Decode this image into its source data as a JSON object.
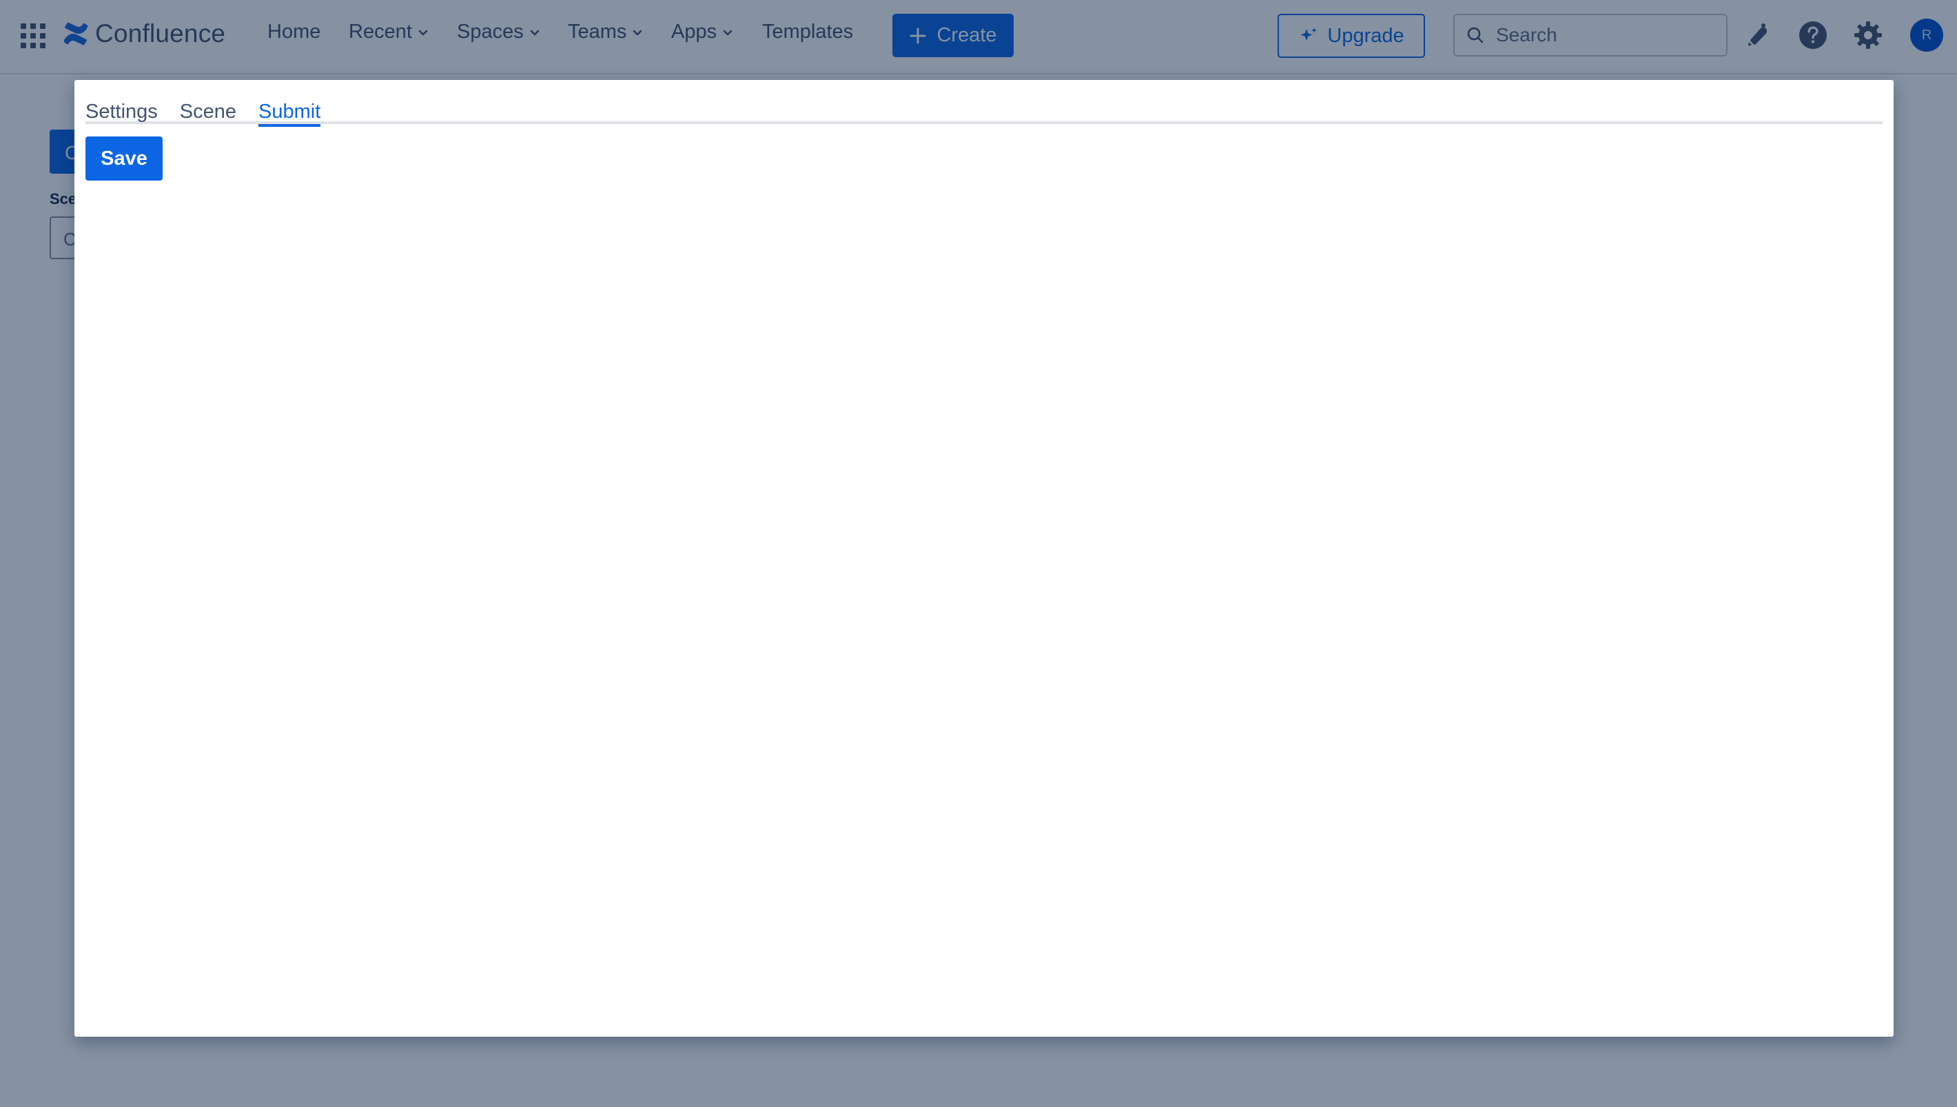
{
  "app": {
    "product_name": "Confluence",
    "brand_color": "#0c66e4"
  },
  "topnav": {
    "items": [
      {
        "label": "Home",
        "has_dropdown": false
      },
      {
        "label": "Recent",
        "has_dropdown": true
      },
      {
        "label": "Spaces",
        "has_dropdown": true
      },
      {
        "label": "Teams",
        "has_dropdown": true
      },
      {
        "label": "Apps",
        "has_dropdown": true
      },
      {
        "label": "Templates",
        "has_dropdown": false
      }
    ],
    "create_label": "Create",
    "upgrade_label": "Upgrade",
    "search_placeholder": "Search",
    "icons": [
      "app-switcher-icon",
      "confluence-logo-icon",
      "plus-icon",
      "sparkle-icon",
      "search-icon",
      "notification-icon",
      "help-icon",
      "settings-icon"
    ],
    "avatar_initial": "R"
  },
  "background_page": {
    "button_label": "C",
    "field_label": "Sce",
    "field_value": "C"
  },
  "modal": {
    "tabs": [
      {
        "label": "Settings",
        "active": false
      },
      {
        "label": "Scene",
        "active": false
      },
      {
        "label": "Submit",
        "active": true
      }
    ],
    "save_label": "Save"
  }
}
